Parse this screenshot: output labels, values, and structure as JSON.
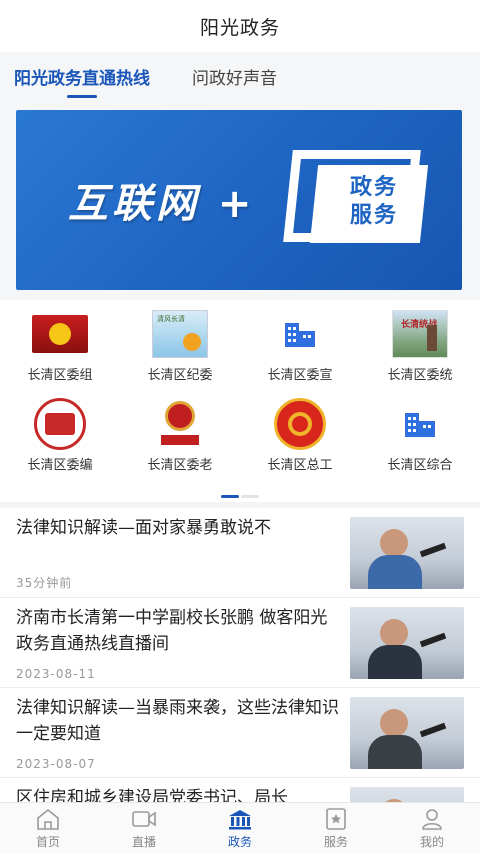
{
  "header": {
    "title": "阳光政务"
  },
  "tabs": [
    {
      "label": "阳光政务直通热线",
      "active": true
    },
    {
      "label": "问政好声音",
      "active": false
    }
  ],
  "banner": {
    "text": "互联网 +",
    "box_text_1": "政务",
    "box_text_2": "服务"
  },
  "grid": [
    {
      "label": "长清区委组",
      "icon": "party-flag-icon"
    },
    {
      "label": "长清区纪委",
      "icon": "discipline-photo-icon"
    },
    {
      "label": "长清区委宣",
      "icon": "building-icon"
    },
    {
      "label": "长清区委统",
      "icon": "united-front-photo-icon"
    },
    {
      "label": "长清区委编",
      "icon": "organization-badge-icon"
    },
    {
      "label": "长清区委老",
      "icon": "veteran-cadre-icon"
    },
    {
      "label": "长清区总工",
      "icon": "trade-union-icon"
    },
    {
      "label": "长清区综合",
      "icon": "building-icon"
    }
  ],
  "news": [
    {
      "headline": "法律知识解读—面对家暴勇敢说不",
      "date": "35分钟前"
    },
    {
      "headline": "济南市长清第一中学副校长张鹏 做客阳光政务直通热线直播间",
      "date": "2023-08-11"
    },
    {
      "headline": "法律知识解读—当暴雨来袭，这些法律知识一定要知道",
      "date": "2023-08-07"
    },
    {
      "headline": "区住房和城乡建设局党委书记、局长",
      "date": ""
    }
  ],
  "tabbar": [
    {
      "label": "首页",
      "icon": "home-icon",
      "active": false
    },
    {
      "label": "直播",
      "icon": "video-camera-icon",
      "active": false
    },
    {
      "label": "政务",
      "icon": "government-building-icon",
      "active": true
    },
    {
      "label": "服务",
      "icon": "star-bookmark-icon",
      "active": false
    },
    {
      "label": "我的",
      "icon": "user-icon",
      "active": false
    }
  ],
  "colors": {
    "accent": "#1a56b8",
    "banner": "#1e64c2"
  }
}
